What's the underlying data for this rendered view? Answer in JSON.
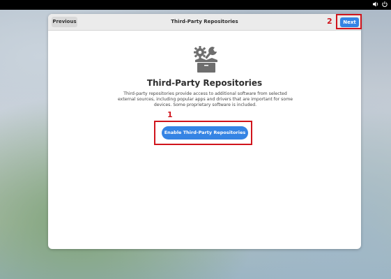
{
  "topbar": {
    "volume_icon": "volume-icon",
    "power_icon": "power-icon"
  },
  "header": {
    "previous_label": "Previous",
    "title": "Third-Party Repositories",
    "next_label": "Next"
  },
  "main": {
    "icon": "settings-box-icon",
    "heading": "Third-Party Repositories",
    "description": "Third-party repositories provide access to additional software from selected external sources, including popular apps and drivers that are important for some devices. Some proprietary software is included.",
    "enable_label": "Enable Third-Party Repositories"
  },
  "annotations": {
    "marker_1": "1",
    "marker_2": "2"
  },
  "colors": {
    "accent": "#3584e4",
    "highlight": "#d0141c"
  }
}
